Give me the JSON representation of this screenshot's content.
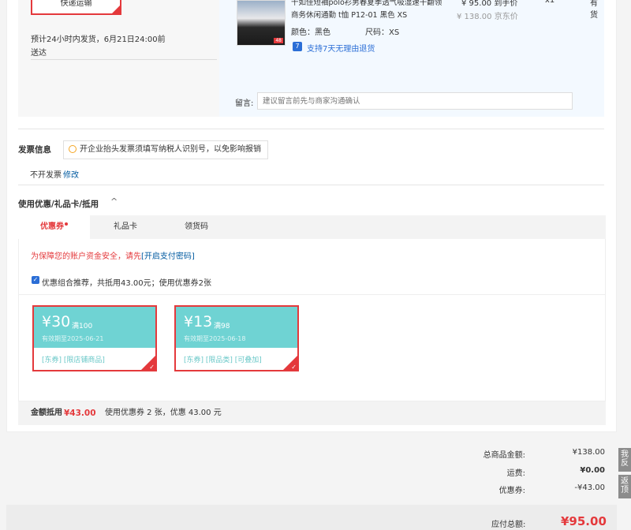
{
  "shipping": {
    "express_button": "快递运输",
    "delivery_note": "预计24小时内发货，6月21日24:00前",
    "delivery_note2": "送达"
  },
  "product": {
    "title_line1": "千如佳短袖polo衫男春夏季透气吸湿速干翻领",
    "title_line2": "商务休闲通勤 t恤 P12-01 黑色 XS",
    "price": "¥ 95.00",
    "price_label": "到手价",
    "original_price": "¥ 138.00",
    "original_label": "京东价",
    "quantity": "x1",
    "stock": "有货",
    "color_label": "颜色：",
    "color_value": "黑色",
    "size_label": "尺码：",
    "size_value": "XS",
    "return_badge": "7",
    "return_text": "支持7天无理由退货",
    "thumb_badge": "48"
  },
  "message": {
    "label": "留言:",
    "placeholder": "建议留言前先与商家沟通确认"
  },
  "invoice": {
    "title": "发票信息",
    "tip": "开企业抬头发票须填写纳税人识别号，以免影响报销",
    "status": "不开发票",
    "modify_link": "修改"
  },
  "discount": {
    "title": "使用优惠/礼品卡/抵用",
    "tabs": [
      "优惠券",
      "礼品卡",
      "领货码"
    ],
    "security_warning": "为保障您的账户资金安全，请先",
    "security_link": "[开启支付密码]",
    "combo_text": "优惠组合推荐，共抵用43.00元；使用优惠券2张",
    "coupons": [
      {
        "amount": "¥30",
        "condition": "满100",
        "expiry": "有效期至2025-06-21",
        "tags": "[东券] [限店铺商品]"
      },
      {
        "amount": "¥13",
        "condition": "满98",
        "expiry": "有效期至2025-06-18",
        "tags": "[东券] [限品类] [可叠加]"
      }
    ],
    "footer_label": "金额抵用",
    "footer_amount": "¥43.00",
    "footer_desc": "使用优惠券 2 张，优惠 43.00 元"
  },
  "summary": {
    "rows": [
      {
        "label": "总商品金额:",
        "value": "¥138.00"
      },
      {
        "label": "运费:",
        "value": "¥0.00"
      },
      {
        "label": "优惠券:",
        "value": "-¥43.00"
      }
    ],
    "total_label": "应付总额:",
    "total_value": "¥95.00"
  },
  "sidebar": {
    "feedback": "我\n反",
    "back_top": "返\n顶"
  },
  "colors": {
    "accent": "#e4393c",
    "coupon": "#6fd3d3",
    "link": "#005aa0"
  }
}
